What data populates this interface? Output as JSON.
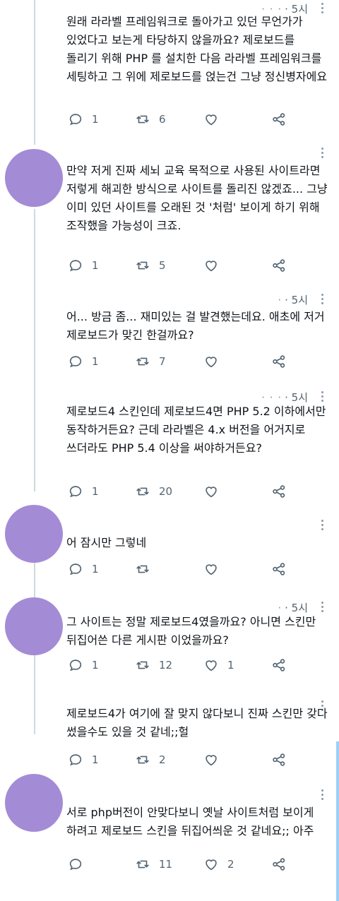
{
  "tweets": [
    {
      "time": "5시",
      "text": "원래 라라벨 프레임워크로 돌아가고 있던 무언가가 있었다고 보는게 타당하지 않을까요? 제로보드를 돌리기 위해 PHP 를 설치한 다음 라라벨 프레임워크를 세팅하고 그 위에 제로보드를 얹는건 그냥 정신병자에요",
      "reply": "1",
      "retweet": "6",
      "like": ""
    },
    {
      "time": "",
      "text": "만약 저게 진짜 세뇌 교육 목적으로 사용된 사이트라면 저렇게 해괴한 방식으로 사이트를 돌리진 않겠죠... 그냥 이미 있던 사이트를 오래된 것 '처럼' 보이게 하기 위해 조작했을 가능성이 크죠.",
      "reply": "1",
      "retweet": "5",
      "like": ""
    },
    {
      "time": "5시",
      "text": "어... 방금 좀... 재미있는 걸 발견했는데요. 애초에 저거 제로보드가 맞긴 한걸까요?",
      "reply": "1",
      "retweet": "7",
      "like": ""
    },
    {
      "time": "5시",
      "text": "제로보드4 스킨인데 제로보드4면 PHP 5.2 이하에서만 동작하거든요? 근데 라라벨은 4.x 버전을 어거지로 쓰더라도 PHP 5.4 이상을 써야하거든요?",
      "reply": "1",
      "retweet": "20",
      "like": ""
    },
    {
      "time": "",
      "text": "어 잠시만 그렇네",
      "reply": "1",
      "retweet": "",
      "like": ""
    },
    {
      "time": "5시",
      "text": "그 사이트는 정말 제로보드4였을까요? 아니면 스킨만 뒤집어쓴 다른 게시판 이었을까요?",
      "reply": "1",
      "retweet": "12",
      "like": "1"
    },
    {
      "time": "",
      "text": "제로보드4가 여기에 잘 맞지 않다보니 진짜 스킨만 갖다 썼을수도 있을 것 같네;;헐",
      "reply": "1",
      "retweet": "2",
      "like": ""
    },
    {
      "time": "",
      "text": "서로 php버전이 안맞다보니 옛날 사이트처럼 보이게 하려고 제로보드 스킨을 뒤집어씌운 것 같네요;; 아주",
      "reply": "",
      "retweet": "11",
      "like": "2"
    }
  ],
  "colors": {
    "avatar": "#a48bd6",
    "icon": "#536471",
    "scrollbar": "#9ecff5"
  },
  "icons": {
    "reply": "reply-icon",
    "retweet": "retweet-icon",
    "like": "heart-icon",
    "share": "share-icon",
    "more": "more-icon"
  }
}
